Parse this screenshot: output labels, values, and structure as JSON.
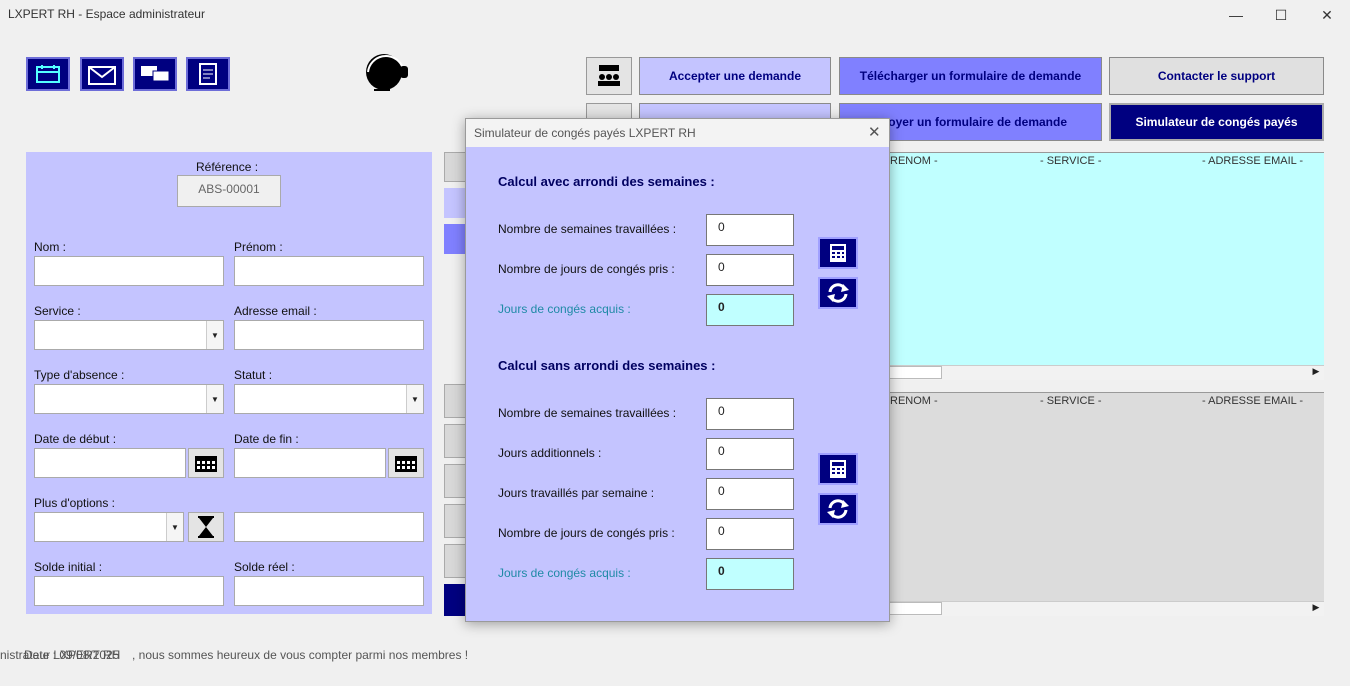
{
  "window": {
    "title": "LXPERT RH - Espace administrateur"
  },
  "toolbar": {
    "accept_label": "Accepter une demande",
    "download_label": "Télécharger un formulaire de demande",
    "support_label": "Contacter le support",
    "send_label": "oyer un formulaire de demande",
    "simulator_label": "Simulateur de congés payés"
  },
  "form": {
    "reference_label": "Référence :",
    "reference_value": "ABS-00001",
    "nom_label": "Nom :",
    "prenom_label": "Prénom :",
    "service_label": "Service :",
    "email_label": "Adresse email :",
    "type_label": "Type d'absence :",
    "statut_label": "Statut :",
    "debut_label": "Date de début :",
    "fin_label": "Date de fin :",
    "options_label": "Plus d'options :",
    "solde_initial_label": "Solde initial :",
    "solde_reel_label": "Solde réel :"
  },
  "lists": {
    "top_headers": [
      "RENOM -",
      "- SERVICE -",
      "- ADRESSE EMAIL -"
    ],
    "bottom_headers": [
      "RENOM -",
      "- SERVICE -",
      "- ADRESSE EMAIL -"
    ]
  },
  "status_bar": {
    "overlap_text": "nistrateur LXPERT RH",
    "date_text": "Date : 09/08/2025",
    "welcome_text": ", nous sommes heureux de vous compter parmi nos membres !"
  },
  "modal": {
    "title": "Simulateur de congés payés LXPERT RH",
    "section1_title": "Calcul avec arrondi des semaines :",
    "s1_weeks_label": "Nombre de semaines travaillées :",
    "s1_weeks_value": "0",
    "s1_taken_label": "Nombre de jours de congés pris :",
    "s1_taken_value": "0",
    "s1_acquired_label": "Jours de congés acquis :",
    "s1_acquired_value": "0",
    "section2_title": "Calcul sans arrondi des semaines :",
    "s2_weeks_label": "Nombre de semaines travaillées :",
    "s2_weeks_value": "0",
    "s2_additional_label": "Jours additionnels :",
    "s2_additional_value": "0",
    "s2_perweek_label": "Jours travaillés par semaine :",
    "s2_perweek_value": "0",
    "s2_taken_label": "Nombre de jours de congés pris :",
    "s2_taken_value": "0",
    "s2_acquired_label": "Jours de congés acquis :",
    "s2_acquired_value": "0"
  }
}
